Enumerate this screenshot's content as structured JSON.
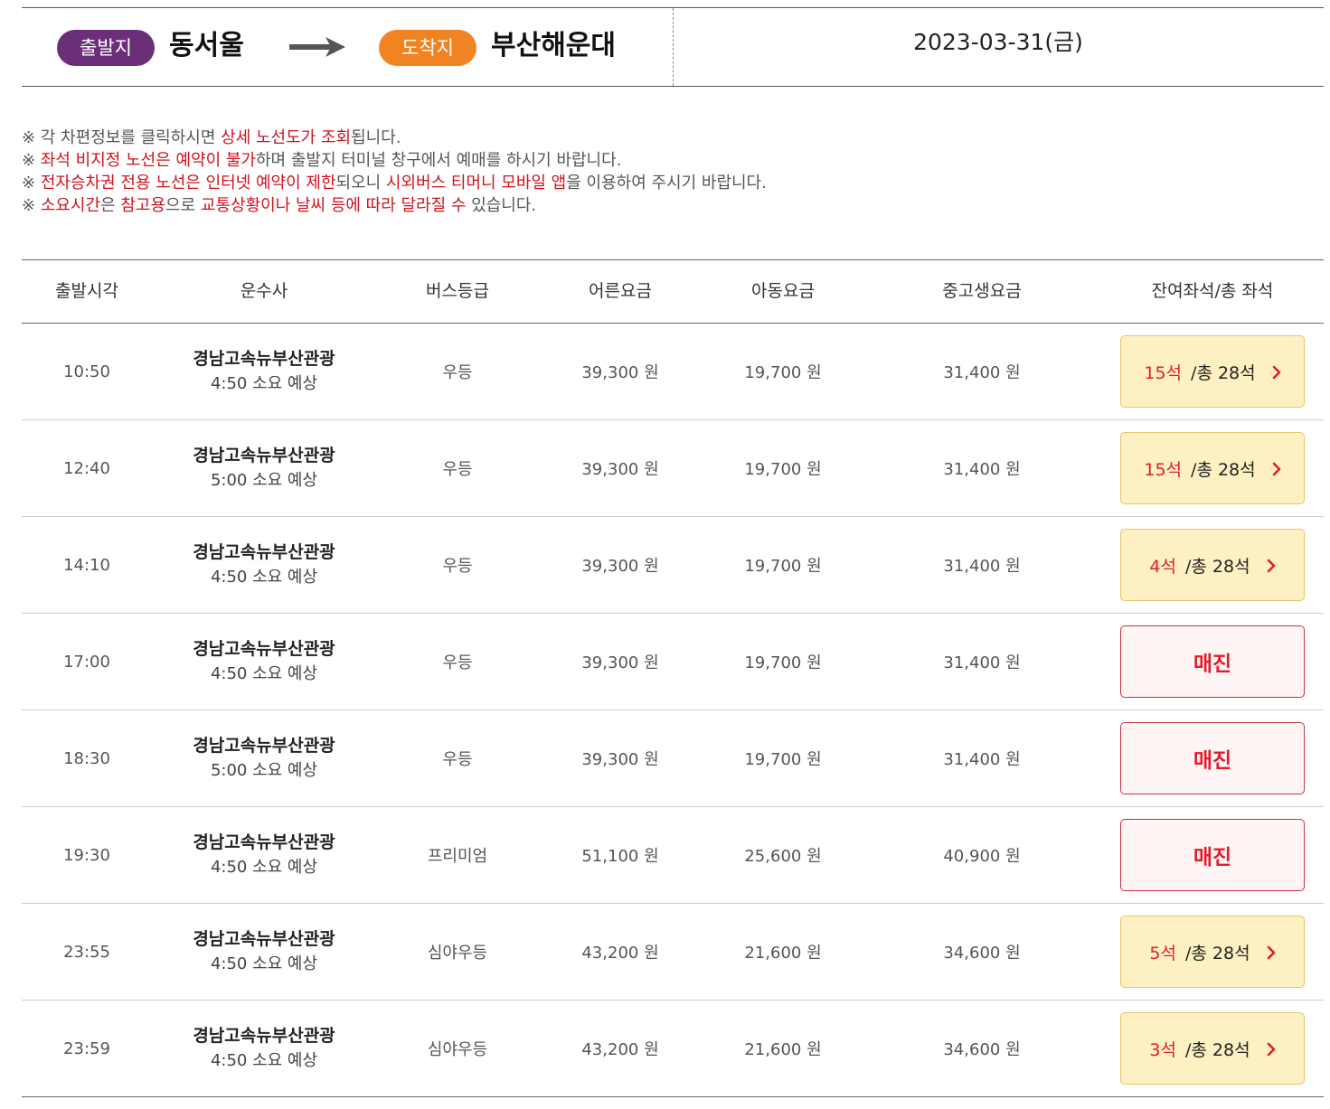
{
  "route": {
    "departure_badge": "출발지",
    "departure": "동서울",
    "arrival_badge": "도착지",
    "arrival": "부산해운대",
    "date": "2023-03-31(금)",
    "colors": {
      "departure_badge": "#6b2f7a",
      "arrival_badge": "#f28322",
      "highlight": "#d0111b"
    }
  },
  "notices": [
    [
      {
        "t": "※ 각 차편정보를 클릭하시면 ",
        "hl": false
      },
      {
        "t": "상세 노선도가 조회",
        "hl": true
      },
      {
        "t": "됩니다.",
        "hl": false
      }
    ],
    [
      {
        "t": "※ ",
        "hl": false
      },
      {
        "t": "좌석 비지정 노선은 예약이 불가",
        "hl": true
      },
      {
        "t": "하며 출발지 터미널 창구에서 예매를 하시기 바랍니다.",
        "hl": false
      }
    ],
    [
      {
        "t": "※ ",
        "hl": false
      },
      {
        "t": "전자승차권 전용 노선은 인터넷 예약이 제한",
        "hl": true
      },
      {
        "t": "되오니 ",
        "hl": false
      },
      {
        "t": "시외버스 티머니 모바일 앱",
        "hl": true
      },
      {
        "t": "을 이용하여 주시기 바랍니다.",
        "hl": false
      }
    ],
    [
      {
        "t": "※ ",
        "hl": false
      },
      {
        "t": "소요시간",
        "hl": true
      },
      {
        "t": "은 ",
        "hl": false
      },
      {
        "t": "참고용",
        "hl": true
      },
      {
        "t": "으로 ",
        "hl": false
      },
      {
        "t": "교통상황이나 날씨 등에 따라 달라질 수",
        "hl": true
      },
      {
        "t": " 있습니다.",
        "hl": false
      }
    ]
  ],
  "table": {
    "headers": [
      "출발시각",
      "운수사",
      "버스등급",
      "어른요금",
      "아동요금",
      "중고생요금",
      "잔여좌석/총 좌석"
    ],
    "rows": [
      {
        "time": "10:50",
        "company": "경남고속뉴부산관광",
        "duration": "4:50 소요 예상",
        "grade": "우등",
        "adult": "39,300 원",
        "child": "19,700 원",
        "teen": "31,400 원",
        "status": "available",
        "remaining": "15석",
        "total": "/총 28석"
      },
      {
        "time": "12:40",
        "company": "경남고속뉴부산관광",
        "duration": "5:00 소요 예상",
        "grade": "우등",
        "adult": "39,300 원",
        "child": "19,700 원",
        "teen": "31,400 원",
        "status": "available",
        "remaining": "15석",
        "total": "/총 28석"
      },
      {
        "time": "14:10",
        "company": "경남고속뉴부산관광",
        "duration": "4:50 소요 예상",
        "grade": "우등",
        "adult": "39,300 원",
        "child": "19,700 원",
        "teen": "31,400 원",
        "status": "available",
        "remaining": "4석",
        "total": "/총 28석"
      },
      {
        "time": "17:00",
        "company": "경남고속뉴부산관광",
        "duration": "4:50 소요 예상",
        "grade": "우등",
        "adult": "39,300 원",
        "child": "19,700 원",
        "teen": "31,400 원",
        "status": "sold_out",
        "sold_label": "매진"
      },
      {
        "time": "18:30",
        "company": "경남고속뉴부산관광",
        "duration": "5:00 소요 예상",
        "grade": "우등",
        "adult": "39,300 원",
        "child": "19,700 원",
        "teen": "31,400 원",
        "status": "sold_out",
        "sold_label": "매진"
      },
      {
        "time": "19:30",
        "company": "경남고속뉴부산관광",
        "duration": "4:50 소요 예상",
        "grade": "프리미엄",
        "adult": "51,100 원",
        "child": "25,600 원",
        "teen": "40,900 원",
        "status": "sold_out",
        "sold_label": "매진"
      },
      {
        "time": "23:55",
        "company": "경남고속뉴부산관광",
        "duration": "4:50 소요 예상",
        "grade": "심야우등",
        "adult": "43,200 원",
        "child": "21,600 원",
        "teen": "34,600 원",
        "status": "available",
        "remaining": "5석",
        "total": "/총 28석"
      },
      {
        "time": "23:59",
        "company": "경남고속뉴부산관광",
        "duration": "4:50 소요 예상",
        "grade": "심야우등",
        "adult": "43,200 원",
        "child": "21,600 원",
        "teen": "34,600 원",
        "status": "available",
        "remaining": "3석",
        "total": "/총 28석"
      }
    ]
  },
  "icons": {
    "route_arrow": "arrow-right-icon",
    "seat_chevron": "chevron-right-icon"
  }
}
